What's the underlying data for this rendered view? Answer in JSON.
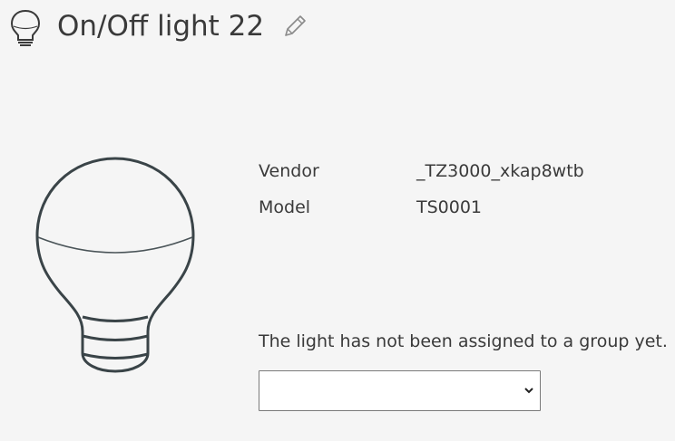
{
  "header": {
    "title": "On/Off light 22",
    "type_icon": "lightbulb-icon",
    "edit_icon": "pencil-icon"
  },
  "device": {
    "illustration": "lightbulb-illustration",
    "properties": [
      {
        "label": "Vendor",
        "value": "_TZ3000_xkap8wtb"
      },
      {
        "label": "Model",
        "value": "TS0001"
      }
    ]
  },
  "group": {
    "note": "The light has not been assigned to a group yet.",
    "select_value": ""
  },
  "colors": {
    "background": "#f5f5f5",
    "text": "#3a3a3a",
    "illustration_stroke": "#3a4448"
  }
}
